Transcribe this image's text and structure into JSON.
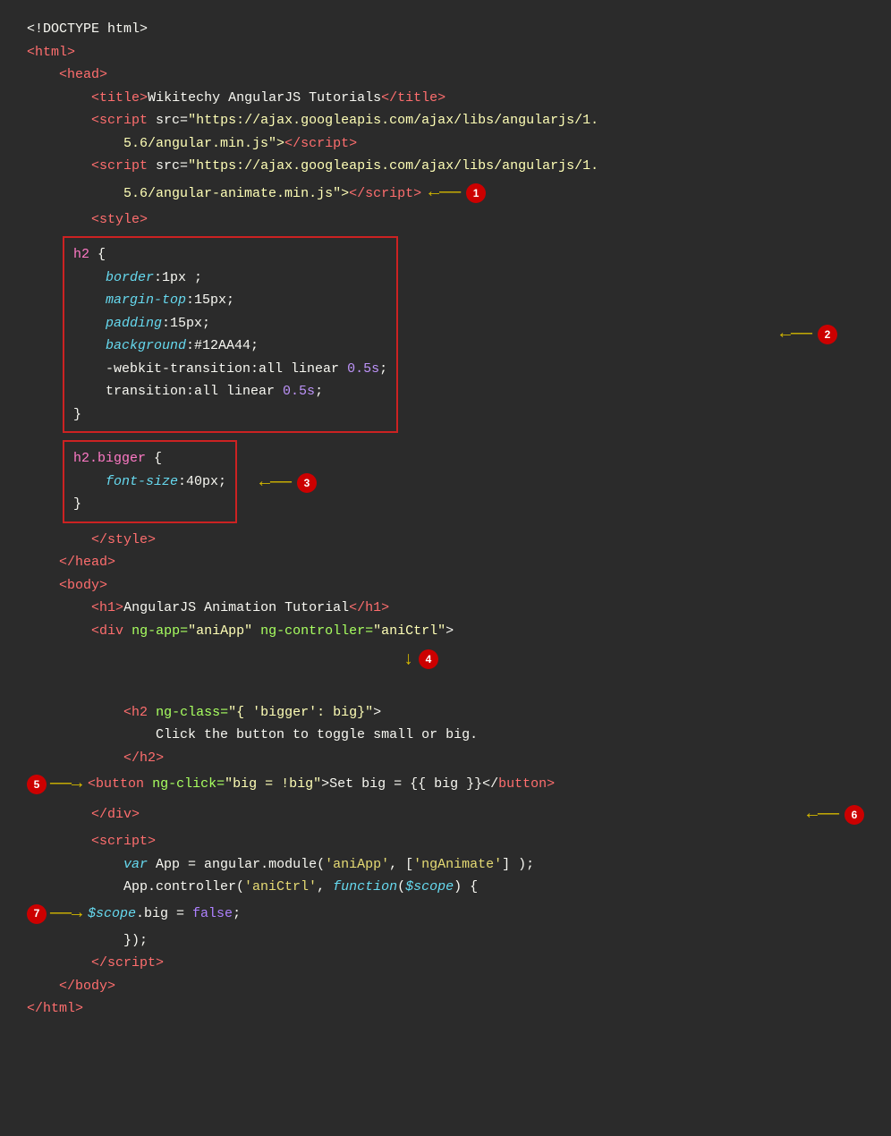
{
  "code": {
    "lines": [
      {
        "id": "l1",
        "tokens": [
          {
            "text": "<!DOCTYPE html>",
            "class": "c-white"
          }
        ]
      },
      {
        "id": "l2",
        "tokens": [
          {
            "text": "<",
            "class": "c-tag"
          },
          {
            "text": "html",
            "class": "c-tag"
          },
          {
            "text": ">",
            "class": "c-tag"
          }
        ]
      },
      {
        "id": "l3",
        "tokens": [
          {
            "text": "    <",
            "class": "c-tag"
          },
          {
            "text": "head",
            "class": "c-tag"
          },
          {
            "text": ">",
            "class": "c-tag"
          }
        ]
      },
      {
        "id": "l4",
        "tokens": [
          {
            "text": "        <",
            "class": "c-tag"
          },
          {
            "text": "title",
            "class": "c-tag"
          },
          {
            "text": ">",
            "class": "c-tag"
          },
          {
            "text": "Wikitechy AngularJS Tutorials",
            "class": "c-white"
          },
          {
            "text": "</",
            "class": "c-tag"
          },
          {
            "text": "title",
            "class": "c-tag"
          },
          {
            "text": ">",
            "class": "c-tag"
          }
        ]
      },
      {
        "id": "l5",
        "tokens": [
          {
            "text": "        <",
            "class": "c-tag"
          },
          {
            "text": "script",
            "class": "c-tag"
          },
          {
            "text": " src=",
            "class": "c-white"
          },
          {
            "text": "\"https://ajax.googleapis.com/ajax/libs/angularjs/1.",
            "class": "c-val"
          }
        ]
      },
      {
        "id": "l6",
        "tokens": [
          {
            "text": "            5.6/angular.min.js\">",
            "class": "c-val"
          },
          {
            "text": "</",
            "class": "c-tag"
          },
          {
            "text": "script",
            "class": "c-tag"
          },
          {
            "text": ">",
            "class": "c-tag"
          }
        ]
      },
      {
        "id": "l7",
        "tokens": [
          {
            "text": "        <",
            "class": "c-tag"
          },
          {
            "text": "script",
            "class": "c-tag"
          },
          {
            "text": " src=",
            "class": "c-white"
          },
          {
            "text": "\"https://ajax.googleapis.com/ajax/libs/angularjs/1.",
            "class": "c-val"
          }
        ]
      },
      {
        "id": "l8",
        "tokens": [
          {
            "text": "            5.6/angular-animate.min.js\">",
            "class": "c-val"
          },
          {
            "text": "</",
            "class": "c-tag"
          },
          {
            "text": "script",
            "class": "c-tag"
          },
          {
            "text": ">",
            "class": "c-tag"
          }
        ]
      },
      {
        "id": "l9",
        "tokens": [
          {
            "text": "        <",
            "class": "c-tag"
          },
          {
            "text": "style",
            "class": "c-tag"
          },
          {
            "text": ">",
            "class": "c-tag"
          }
        ]
      },
      {
        "id": "box1_l1",
        "tokens": [
          {
            "text": "",
            "class": "c-white"
          }
        ]
      },
      {
        "id": "box1_l2",
        "tokens": [
          {
            "text": "            ",
            "class": "c-white"
          },
          {
            "text": "h2",
            "class": "c-pink"
          },
          {
            "text": " {",
            "class": "c-white"
          }
        ]
      },
      {
        "id": "box1_l3",
        "tokens": [
          {
            "text": "                ",
            "class": "c-white"
          },
          {
            "text": "border",
            "class": "c-prop"
          },
          {
            "text": ":1px ;",
            "class": "c-white"
          }
        ]
      },
      {
        "id": "box1_l4",
        "tokens": [
          {
            "text": "                ",
            "class": "c-white"
          },
          {
            "text": "margin-top",
            "class": "c-prop"
          },
          {
            "text": ":15px;",
            "class": "c-white"
          }
        ]
      },
      {
        "id": "box1_l5",
        "tokens": [
          {
            "text": "                ",
            "class": "c-white"
          },
          {
            "text": "padding",
            "class": "c-prop"
          },
          {
            "text": ":15px;",
            "class": "c-white"
          }
        ]
      },
      {
        "id": "box1_l6",
        "tokens": [
          {
            "text": "                ",
            "class": "c-white"
          },
          {
            "text": "background",
            "class": "c-prop"
          },
          {
            "text": ":#12AA44;",
            "class": "c-white"
          }
        ]
      },
      {
        "id": "box1_l7",
        "tokens": [
          {
            "text": "                ",
            "class": "c-white"
          },
          {
            "text": "-webkit-transition",
            "class": "c-white"
          },
          {
            "text": ":all linear ",
            "class": "c-white"
          },
          {
            "text": "0.5s",
            "class": "c-purple"
          },
          {
            "text": ";",
            "class": "c-white"
          }
        ]
      },
      {
        "id": "box1_l8",
        "tokens": [
          {
            "text": "                ",
            "class": "c-white"
          },
          {
            "text": "transition",
            "class": "c-white"
          },
          {
            "text": ":all linear ",
            "class": "c-white"
          },
          {
            "text": "0.5s",
            "class": "c-purple"
          },
          {
            "text": ";",
            "class": "c-white"
          }
        ]
      },
      {
        "id": "box1_l9",
        "tokens": [
          {
            "text": "            }",
            "class": "c-white"
          }
        ]
      },
      {
        "id": "box1_l10",
        "tokens": [
          {
            "text": "",
            "class": "c-white"
          }
        ]
      },
      {
        "id": "box2_l1",
        "tokens": [
          {
            "text": "            ",
            "class": "c-white"
          },
          {
            "text": "h2.bigger",
            "class": "c-pink"
          },
          {
            "text": " {",
            "class": "c-white"
          }
        ]
      },
      {
        "id": "box2_l2",
        "tokens": [
          {
            "text": "                ",
            "class": "c-white"
          },
          {
            "text": "font-size",
            "class": "c-prop"
          },
          {
            "text": ":40px;",
            "class": "c-white"
          }
        ]
      },
      {
        "id": "box2_l3",
        "tokens": [
          {
            "text": "            }",
            "class": "c-white"
          }
        ]
      },
      {
        "id": "l_style_end",
        "tokens": [
          {
            "text": "        </",
            "class": "c-tag"
          },
          {
            "text": "style",
            "class": "c-tag"
          },
          {
            "text": ">",
            "class": "c-tag"
          }
        ]
      },
      {
        "id": "l_head_end",
        "tokens": [
          {
            "text": "    </",
            "class": "c-tag"
          },
          {
            "text": "head",
            "class": "c-tag"
          },
          {
            "text": ">",
            "class": "c-tag"
          }
        ]
      },
      {
        "id": "l_body",
        "tokens": [
          {
            "text": "    <",
            "class": "c-tag"
          },
          {
            "text": "body",
            "class": "c-tag"
          },
          {
            "text": ">",
            "class": "c-tag"
          }
        ]
      },
      {
        "id": "l_h1",
        "tokens": [
          {
            "text": "        <",
            "class": "c-tag"
          },
          {
            "text": "h1",
            "class": "c-tag"
          },
          {
            "text": ">AngularJS Animation Tutorial</",
            "class": "c-white"
          },
          {
            "text": "h1",
            "class": "c-tag"
          },
          {
            "text": ">",
            "class": "c-tag"
          }
        ]
      },
      {
        "id": "l_div",
        "tokens": [
          {
            "text": "        <",
            "class": "c-tag"
          },
          {
            "text": "div",
            "class": "c-tag"
          },
          {
            "text": " ng-app=",
            "class": "c-attr"
          },
          {
            "text": "\"aniApp\"",
            "class": "c-val"
          },
          {
            "text": " ng-controller=",
            "class": "c-attr"
          },
          {
            "text": "\"aniCtrl\"",
            "class": "c-val"
          },
          {
            "text": ">",
            "class": "c-white"
          }
        ]
      },
      {
        "id": "l_empty1",
        "tokens": [
          {
            "text": "",
            "class": "c-white"
          }
        ]
      },
      {
        "id": "l_empty2",
        "tokens": [
          {
            "text": "",
            "class": "c-white"
          }
        ]
      },
      {
        "id": "l_h2ng",
        "tokens": [
          {
            "text": "            <",
            "class": "c-tag"
          },
          {
            "text": "h2",
            "class": "c-tag"
          },
          {
            "text": " ng-class=",
            "class": "c-attr"
          },
          {
            "text": "\"{",
            "class": "c-val"
          },
          {
            "text": " 'bigger': big",
            "class": "c-val"
          },
          {
            "text": "}\"",
            "class": "c-val"
          },
          {
            "text": ">",
            "class": "c-white"
          }
        ]
      },
      {
        "id": "l_click",
        "tokens": [
          {
            "text": "                Click the button to toggle small or big.",
            "class": "c-white"
          }
        ]
      },
      {
        "id": "l_h2end",
        "tokens": [
          {
            "text": "            </",
            "class": "c-tag"
          },
          {
            "text": "h2",
            "class": "c-tag"
          },
          {
            "text": ">",
            "class": "c-tag"
          }
        ]
      },
      {
        "id": "l_button",
        "tokens": [
          {
            "text": "        <",
            "class": "c-tag"
          },
          {
            "text": "button",
            "class": "c-tag"
          },
          {
            "text": " ng-click=",
            "class": "c-attr"
          },
          {
            "text": "\"big = !big\"",
            "class": "c-val"
          },
          {
            "text": ">Set big = {{ big }}</",
            "class": "c-white"
          },
          {
            "text": "button",
            "class": "c-tag"
          },
          {
            "text": ">",
            "class": "c-tag"
          }
        ]
      },
      {
        "id": "l_divend",
        "tokens": [
          {
            "text": "        </",
            "class": "c-tag"
          },
          {
            "text": "div",
            "class": "c-tag"
          },
          {
            "text": ">",
            "class": "c-tag"
          }
        ]
      },
      {
        "id": "l_script2",
        "tokens": [
          {
            "text": "        <",
            "class": "c-tag"
          },
          {
            "text": "script",
            "class": "c-tag"
          },
          {
            "text": ">",
            "class": "c-tag"
          }
        ]
      },
      {
        "id": "l_var",
        "tokens": [
          {
            "text": "            ",
            "class": "c-white"
          },
          {
            "text": "var",
            "class": "c-jsvar"
          },
          {
            "text": " App = angular.module(",
            "class": "c-white"
          },
          {
            "text": "'aniApp'",
            "class": "c-string"
          },
          {
            "text": ", [",
            "class": "c-white"
          },
          {
            "text": "'ngAnimate'",
            "class": "c-string"
          },
          {
            "text": "] );",
            "class": "c-white"
          }
        ]
      },
      {
        "id": "l_ctrl",
        "tokens": [
          {
            "text": "            App.controller(",
            "class": "c-white"
          },
          {
            "text": "'aniCtrl'",
            "class": "c-string"
          },
          {
            "text": ", ",
            "class": "c-white"
          },
          {
            "text": "function",
            "class": "c-func"
          },
          {
            "text": "(",
            "class": "c-white"
          },
          {
            "text": "$scope",
            "class": "c-jsvar"
          },
          {
            "text": ") {",
            "class": "c-white"
          }
        ]
      },
      {
        "id": "l_scope",
        "tokens": [
          {
            "text": "                ",
            "class": "c-white"
          },
          {
            "text": "$scope",
            "class": "c-jsvar"
          },
          {
            "text": ".big = ",
            "class": "c-white"
          },
          {
            "text": "false",
            "class": "c-jsval"
          },
          {
            "text": ";",
            "class": "c-white"
          }
        ]
      },
      {
        "id": "l_close1",
        "tokens": [
          {
            "text": "            });",
            "class": "c-white"
          }
        ]
      },
      {
        "id": "l_scriptend",
        "tokens": [
          {
            "text": "        </",
            "class": "c-tag"
          },
          {
            "text": "script",
            "class": "c-tag"
          },
          {
            "text": ">",
            "class": "c-tag"
          }
        ]
      },
      {
        "id": "l_bodyend",
        "tokens": [
          {
            "text": "    </",
            "class": "c-tag"
          },
          {
            "text": "body",
            "class": "c-tag"
          },
          {
            "text": ">",
            "class": "c-tag"
          }
        ]
      },
      {
        "id": "l_htmlend",
        "tokens": [
          {
            "text": "</",
            "class": "c-tag"
          },
          {
            "text": "html",
            "class": "c-tag"
          },
          {
            "text": ">",
            "class": "c-tag"
          }
        ]
      }
    ],
    "annotations": {
      "badge1": "1",
      "badge2": "2",
      "badge3": "3",
      "badge4": "4",
      "badge5": "5",
      "badge6": "6",
      "badge7": "7"
    }
  }
}
